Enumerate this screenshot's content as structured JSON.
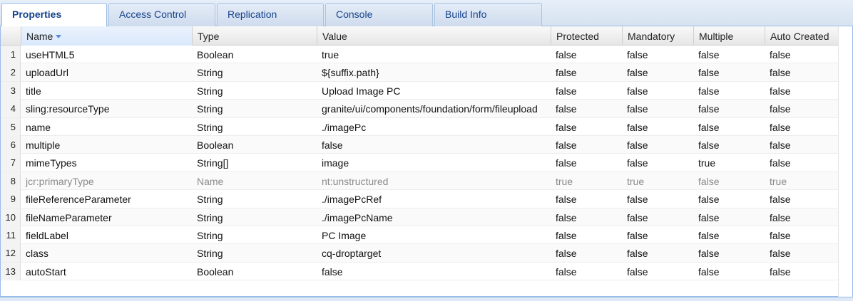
{
  "tabs": [
    {
      "label": "Properties",
      "active": true
    },
    {
      "label": "Access Control",
      "active": false
    },
    {
      "label": "Replication",
      "active": false
    },
    {
      "label": "Console",
      "active": false
    },
    {
      "label": "Build Info",
      "active": false
    }
  ],
  "columns": {
    "name": "Name",
    "type": "Type",
    "value": "Value",
    "protected": "Protected",
    "mandatory": "Mandatory",
    "multiple": "Multiple",
    "auto_created": "Auto Created"
  },
  "sort": {
    "column": "Name",
    "direction": "descending-icon"
  },
  "rows": [
    {
      "num": "1",
      "name": "useHTML5",
      "type": "Boolean",
      "value": "true",
      "protected": "false",
      "mandatory": "false",
      "multiple": "false",
      "auto_created": "false",
      "dim": false
    },
    {
      "num": "2",
      "name": "uploadUrl",
      "type": "String",
      "value": "${suffix.path}",
      "protected": "false",
      "mandatory": "false",
      "multiple": "false",
      "auto_created": "false",
      "dim": false
    },
    {
      "num": "3",
      "name": "title",
      "type": "String",
      "value": "Upload Image PC",
      "protected": "false",
      "mandatory": "false",
      "multiple": "false",
      "auto_created": "false",
      "dim": false
    },
    {
      "num": "4",
      "name": "sling:resourceType",
      "type": "String",
      "value": "granite/ui/components/foundation/form/fileupload",
      "protected": "false",
      "mandatory": "false",
      "multiple": "false",
      "auto_created": "false",
      "dim": false
    },
    {
      "num": "5",
      "name": "name",
      "type": "String",
      "value": "./imagePc",
      "protected": "false",
      "mandatory": "false",
      "multiple": "false",
      "auto_created": "false",
      "dim": false
    },
    {
      "num": "6",
      "name": "multiple",
      "type": "Boolean",
      "value": "false",
      "protected": "false",
      "mandatory": "false",
      "multiple": "false",
      "auto_created": "false",
      "dim": false
    },
    {
      "num": "7",
      "name": "mimeTypes",
      "type": "String[]",
      "value": "image",
      "protected": "false",
      "mandatory": "false",
      "multiple": "true",
      "auto_created": "false",
      "dim": false
    },
    {
      "num": "8",
      "name": "jcr:primaryType",
      "type": "Name",
      "value": "nt:unstructured",
      "protected": "true",
      "mandatory": "true",
      "multiple": "false",
      "auto_created": "true",
      "dim": true
    },
    {
      "num": "9",
      "name": "fileReferenceParameter",
      "type": "String",
      "value": "./imagePcRef",
      "protected": "false",
      "mandatory": "false",
      "multiple": "false",
      "auto_created": "false",
      "dim": false
    },
    {
      "num": "10",
      "name": "fileNameParameter",
      "type": "String",
      "value": "./imagePcName",
      "protected": "false",
      "mandatory": "false",
      "multiple": "false",
      "auto_created": "false",
      "dim": false
    },
    {
      "num": "11",
      "name": "fieldLabel",
      "type": "String",
      "value": "PC Image",
      "protected": "false",
      "mandatory": "false",
      "multiple": "false",
      "auto_created": "false",
      "dim": false
    },
    {
      "num": "12",
      "name": "class",
      "type": "String",
      "value": "cq-droptarget",
      "protected": "false",
      "mandatory": "false",
      "multiple": "false",
      "auto_created": "false",
      "dim": false
    },
    {
      "num": "13",
      "name": "autoStart",
      "type": "Boolean",
      "value": "false",
      "protected": "false",
      "mandatory": "false",
      "multiple": "false",
      "auto_created": "false",
      "dim": false
    }
  ]
}
